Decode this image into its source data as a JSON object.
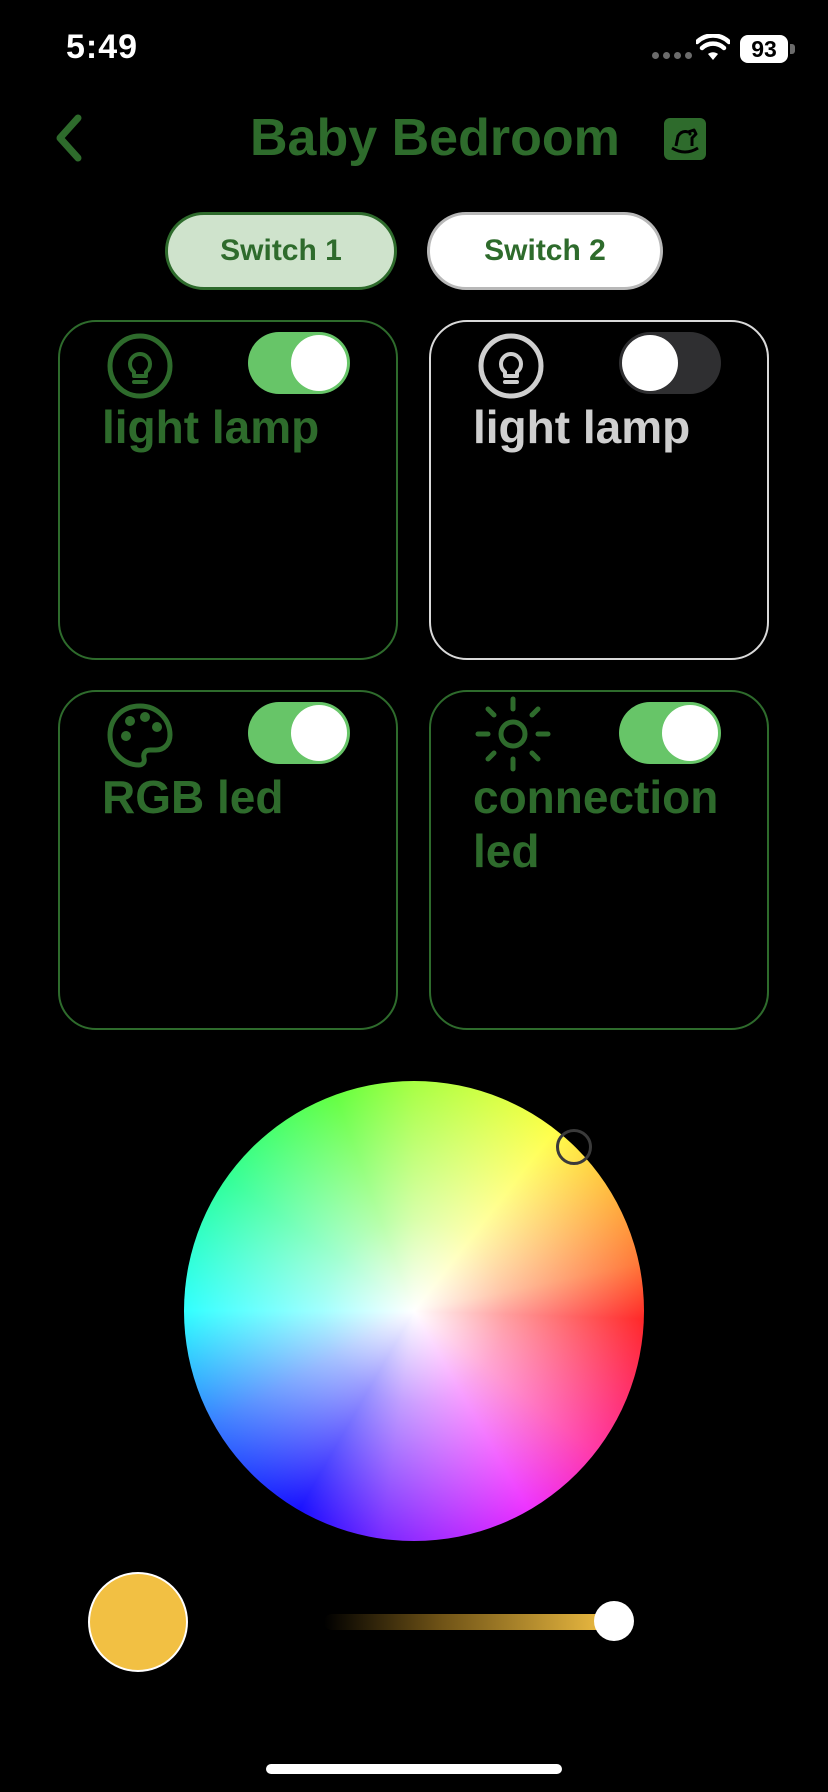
{
  "status_bar": {
    "time": "5:49",
    "battery": "93"
  },
  "header": {
    "title": "Baby Bedroom",
    "back_icon": "chevron-left-icon",
    "room_icon": "rocking-horse-icon"
  },
  "tabs": [
    {
      "label": "Switch 1",
      "selected": true
    },
    {
      "label": "Switch 2",
      "selected": false
    }
  ],
  "devices": [
    {
      "label": "light lamp",
      "icon": "lightbulb-icon",
      "on": true
    },
    {
      "label": "light lamp",
      "icon": "lightbulb-icon",
      "on": false
    },
    {
      "label": "RGB led",
      "icon": "palette-icon",
      "on": true
    },
    {
      "label": "connection led",
      "icon": "sun-icon",
      "on": true
    }
  ],
  "color_picker": {
    "selected_color": "#f2c043",
    "brightness": 1.0
  },
  "colors": {
    "accent": "#2e6b2c",
    "toggle_on": "#67c568",
    "toggle_off": "#2f2f31",
    "tab_selected_bg": "#cfe3cc"
  }
}
